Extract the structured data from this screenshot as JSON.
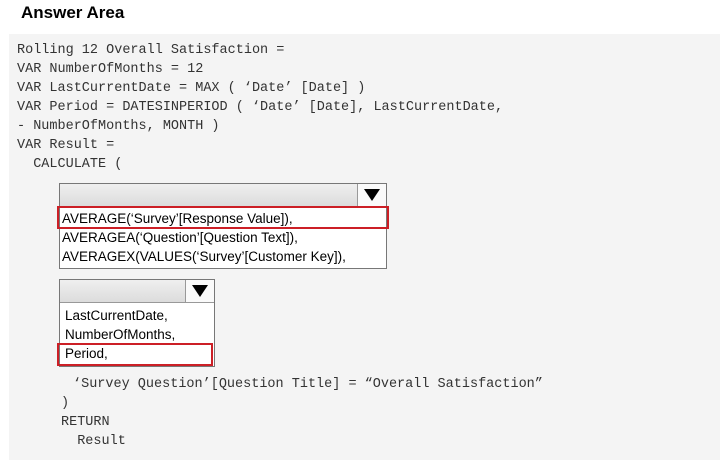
{
  "title": "Answer Area",
  "code_top": [
    "Rolling 12 Overall Satisfaction =",
    "VAR NumberOfMonths = 12",
    "VAR LastCurrentDate = MAX ( ‘Date’ [Date] )",
    "VAR Period = DATESINPERIOD ( ‘Date’ [Date], LastCurrentDate,",
    "- NumberOfMonths, MONTH )",
    "VAR Result =",
    "  CALCULATE ("
  ],
  "dropdown1": {
    "options": [
      "AVERAGE(‘Survey’[Response Value]),",
      "AVERAGEA(‘Question’[Question Text]),",
      "AVERAGEX(VALUES(‘Survey’[Customer Key]),"
    ],
    "selected_index": 0
  },
  "dropdown2": {
    "options": [
      "LastCurrentDate,",
      "NumberOfMonths,",
      "Period,"
    ],
    "selected_index": 2
  },
  "code_bottom": [
    "‘Survey Question’[Question Title] = “Overall Satisfaction”",
    ")",
    "RETURN",
    "  Result"
  ],
  "colors": {
    "selection_border": "#cc1f26",
    "panel_background": "#f4f4f4"
  },
  "icons": {
    "dropdown_arrow": "triangle-down-icon"
  }
}
